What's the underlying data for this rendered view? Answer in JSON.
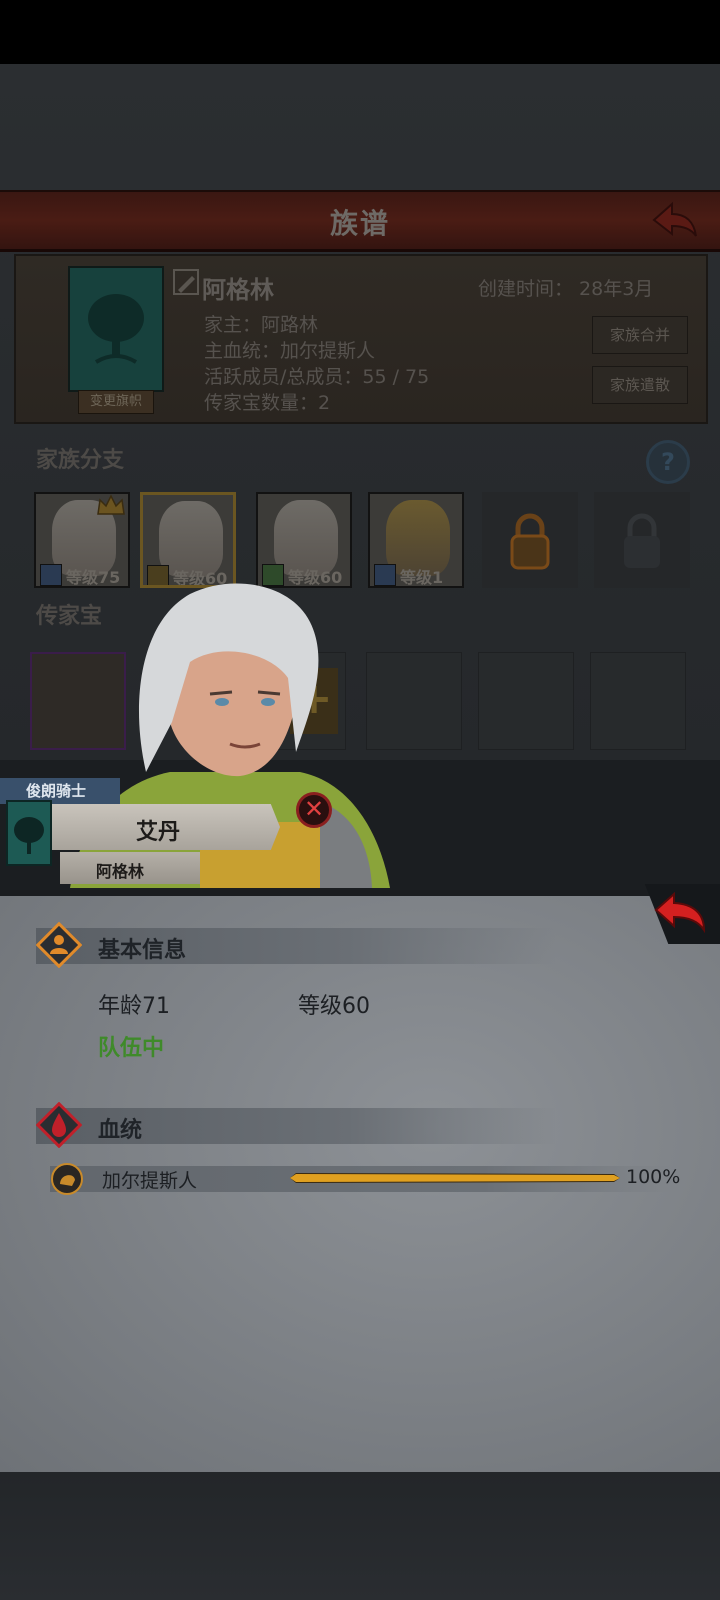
{
  "header": {
    "title": "族谱"
  },
  "family": {
    "name": "阿格林",
    "created": "创建时间： 28年3月",
    "head": "家主：阿路林",
    "bloodline": "主血统：加尔提斯人",
    "members": "活跃成员/总成员：55 / 75",
    "heirlooms_count": "传家宝数量：2",
    "change_banner": "变更旗帜",
    "merge_button": "家族合并",
    "disband_button": "家族遣散"
  },
  "branches": {
    "title": "家族分支",
    "items": [
      {
        "level": "等级75"
      },
      {
        "level": "等级60"
      },
      {
        "level": "等级60"
      },
      {
        "level": "等级1"
      }
    ]
  },
  "heirlooms": {
    "title": "传家宝"
  },
  "character": {
    "title": "俊朗骑士",
    "name": "艾丹",
    "family": "阿格林"
  },
  "basic_info": {
    "label": "基本信息",
    "age": "年龄71",
    "level": "等级60",
    "status": "队伍中"
  },
  "bloodline_section": {
    "label": "血统",
    "entries": [
      {
        "name": "加尔提斯人",
        "percent": "100%",
        "fraction": 1.0
      }
    ]
  },
  "colors": {
    "accent_orange": "#e08a2a",
    "status_green": "#3f8a2a",
    "header_red": "#4a1c14"
  }
}
